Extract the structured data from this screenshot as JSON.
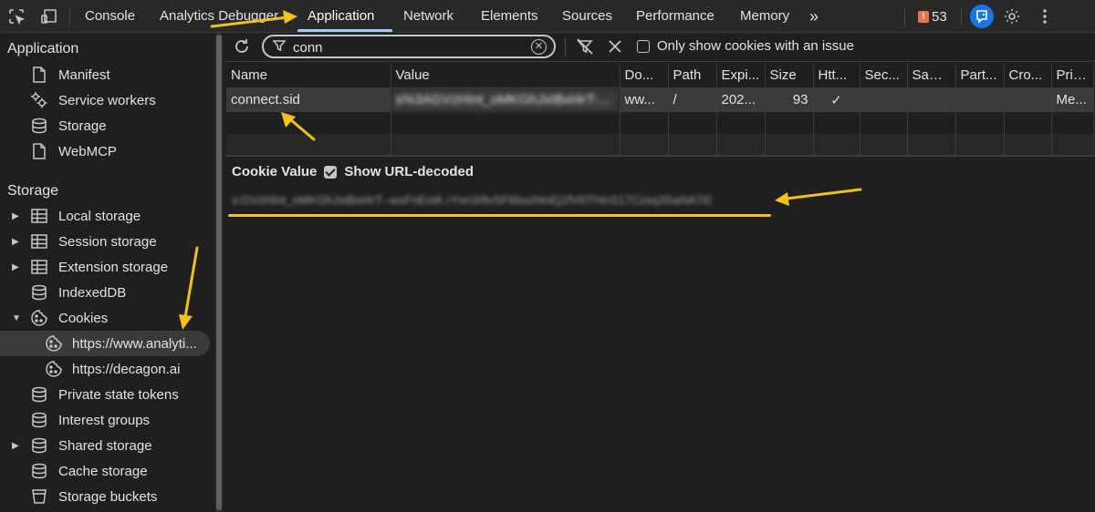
{
  "tabs": [
    {
      "label": "Console"
    },
    {
      "label": "Analytics Debugger"
    },
    {
      "label": "Application",
      "active": true
    },
    {
      "label": "Network"
    },
    {
      "label": "Elements"
    },
    {
      "label": "Sources"
    },
    {
      "label": "Performance"
    },
    {
      "label": "Memory"
    }
  ],
  "more_tabs": "»",
  "issues_count": "53",
  "sidebar": {
    "application_title": "Application",
    "application_items": [
      "Manifest",
      "Service workers",
      "Storage",
      "WebMCP"
    ],
    "storage_title": "Storage",
    "storage_items": [
      "Local storage",
      "Session storage",
      "Extension storage",
      "IndexedDB",
      "Cookies",
      "https://www.analyti...",
      "https://decagon.ai",
      "Private state tokens",
      "Interest groups",
      "Shared storage",
      "Cache storage",
      "Storage buckets"
    ]
  },
  "toolbar": {
    "filter_value": "conn",
    "only_issues_label": "Only show cookies with an issue"
  },
  "table": {
    "columns": [
      "Name",
      "Value",
      "Do...",
      "Path",
      "Expi...",
      "Size",
      "Htt...",
      "Sec...",
      "Sam...",
      "Part...",
      "Cro...",
      "Prio..."
    ],
    "row": [
      "connect.sid",
      "s%3AGVzHInt_oMKGhJxtBxt4rT-...",
      "ww...",
      "/",
      "202...",
      "93",
      "✓",
      "",
      "",
      "",
      "",
      "Me..."
    ]
  },
  "cookie_value": {
    "title": "Cookie Value",
    "show_decoded_label": "Show URL-decoded",
    "value": "s:GVzHInt_oMKGhJxtBxt4rT--wxFnEoiK.rYxn3/8vSF6bxzhtnEj1fVl0THnS17Czsq3SaNA7i0"
  },
  "colors": {
    "accent": "#a8c7fa",
    "annotation": "#f2c11a",
    "background": "#1f1f1f"
  }
}
